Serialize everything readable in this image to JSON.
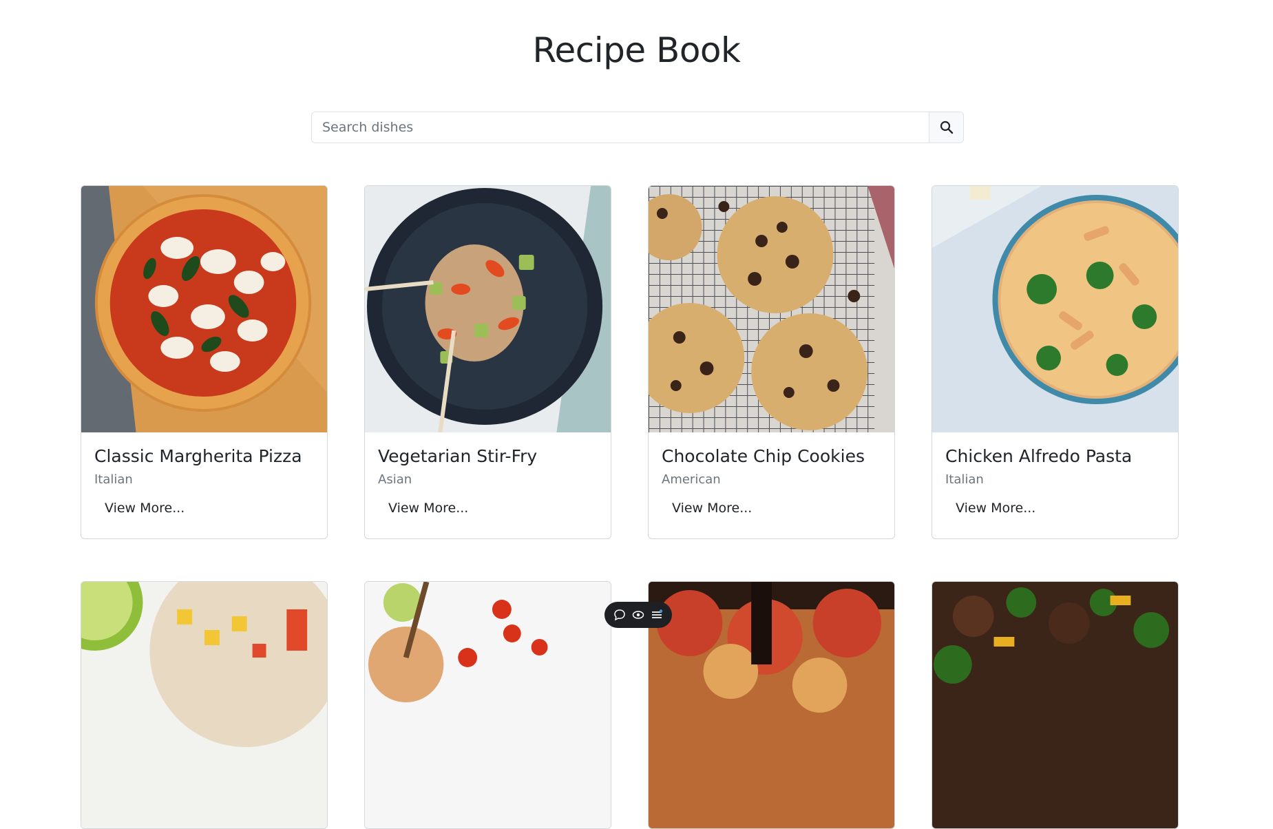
{
  "header": {
    "title": "Recipe Book"
  },
  "search": {
    "placeholder": "Search dishes",
    "value": "",
    "button_icon": "search-icon"
  },
  "recipes": [
    {
      "title": "Classic Margherita Pizza",
      "cuisine": "Italian",
      "button_label": "View More..."
    },
    {
      "title": "Vegetarian Stir-Fry",
      "cuisine": "Asian",
      "button_label": "View More..."
    },
    {
      "title": "Chocolate Chip Cookies",
      "cuisine": "American",
      "button_label": "View More..."
    },
    {
      "title": "Chicken Alfredo Pasta",
      "cuisine": "Italian",
      "button_label": "View More..."
    }
  ],
  "floating_toolbar": {
    "icons": [
      "comment-icon",
      "eye-icon",
      "menu-icon"
    ],
    "accent": "#4a90e2"
  }
}
